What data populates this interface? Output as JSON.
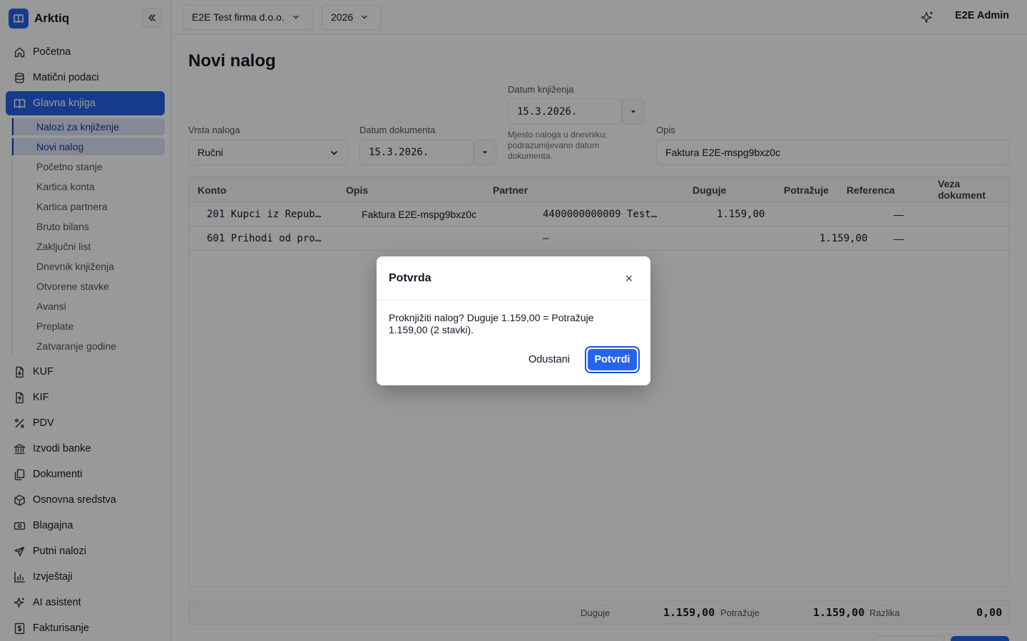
{
  "app": {
    "name": "Arktiq"
  },
  "header": {
    "company": "E2E Test firma d.o.o.",
    "year": "2026",
    "user": "E2E Admin"
  },
  "sidebar": {
    "items_top": [
      {
        "label": "Početna",
        "icon": "home-icon"
      },
      {
        "label": "Matični podaci",
        "icon": "database-icon"
      },
      {
        "label": "Glavna knjiga",
        "icon": "book-icon",
        "active": true
      }
    ],
    "sub_items": [
      {
        "label": "Nalozi za knjiženje"
      },
      {
        "label": "Novi nalog",
        "active": true
      },
      {
        "label": "Početno stanje"
      },
      {
        "label": "Kartica konta"
      },
      {
        "label": "Kartica partnera"
      },
      {
        "label": "Bruto bilans"
      },
      {
        "label": "Zaključni list"
      },
      {
        "label": "Dnevnik knjiženja"
      },
      {
        "label": "Otvorene stavke"
      },
      {
        "label": "Avansi"
      },
      {
        "label": "Preplate"
      },
      {
        "label": "Zatvaranje godine"
      }
    ],
    "items_bottom": [
      {
        "label": "KUF",
        "icon": "file-download-icon"
      },
      {
        "label": "KIF",
        "icon": "file-upload-icon"
      },
      {
        "label": "PDV",
        "icon": "percent-icon"
      },
      {
        "label": "Izvodi banke",
        "icon": "bank-icon"
      },
      {
        "label": "Dokumenti",
        "icon": "documents-icon"
      },
      {
        "label": "Osnovna sredstva",
        "icon": "box-icon"
      },
      {
        "label": "Blagajna",
        "icon": "cash-icon"
      },
      {
        "label": "Putni nalozi",
        "icon": "plane-icon"
      },
      {
        "label": "Izvještaji",
        "icon": "bar-chart-icon"
      },
      {
        "label": "AI asistent",
        "icon": "sparkle-icon"
      },
      {
        "label": "Fakturisanje",
        "icon": "invoice-icon"
      }
    ]
  },
  "page": {
    "title": "Novi nalog"
  },
  "form": {
    "vrsta_label": "Vrsta naloga",
    "vrsta_value": "Ručni",
    "datum_dok_label": "Datum dokumenta",
    "datum_dok_value": "15.3.2026.",
    "datum_knj_label": "Datum knjiženja",
    "datum_knj_value": "15.3.2026.",
    "datum_knj_help": "Mjesto naloga u dnevniku; podrazumijevano datum dokumenta.",
    "opis_label": "Opis",
    "opis_value": "Faktura E2E-mspg9bxz0c"
  },
  "table": {
    "headers": [
      "Konto",
      "Opis",
      "Partner",
      "Duguje",
      "Potražuje",
      "Referenca",
      "Veza dokument"
    ],
    "rows": [
      {
        "konto": "201 Kupci iz Repub…",
        "opis": "Faktura E2E-mspg9bxz0c",
        "partner": "4400000000009 Test…",
        "duguje": "1.159,00",
        "potrazuje": "",
        "referenca": "—"
      },
      {
        "konto": "601 Prihodi od pro…",
        "opis": "",
        "partner": "—",
        "duguje": "",
        "potrazuje": "1.159,00",
        "referenca": "—"
      }
    ]
  },
  "totals": {
    "duguje_label": "Duguje",
    "duguje_value": "1.159,00",
    "potrazuje_label": "Potražuje",
    "potrazuje_value": "1.159,00",
    "razlika_label": "Razlika",
    "razlika_value": "0,00"
  },
  "dialog": {
    "title": "Potvrda",
    "close_glyph": "×",
    "message": "Proknjižiti nalog? Duguje 1.159,00 = Potražuje 1.159,00 (2 stavki).",
    "cancel_label": "Odustani",
    "confirm_label": "Potvrdi"
  },
  "colors": {
    "accent": "#2563eb",
    "accent_dark": "#1d4ed8",
    "sub_active_bg": "#dbe6fb"
  }
}
